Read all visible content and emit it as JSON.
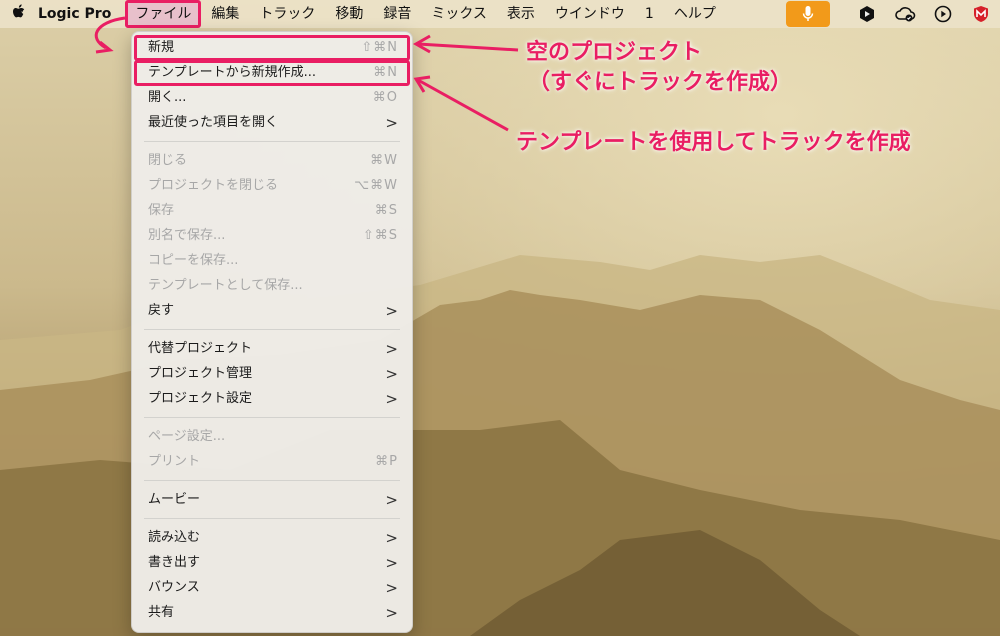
{
  "menubar": {
    "app_name": "Logic Pro",
    "menus": [
      "ファイル",
      "編集",
      "トラック",
      "移動",
      "録音",
      "ミックス",
      "表示",
      "ウインドウ",
      "1",
      "ヘルプ"
    ]
  },
  "file_menu": {
    "items": [
      {
        "label": "新規",
        "shortcut": "⇧⌘N"
      },
      {
        "label": "テンプレートから新規作成...",
        "shortcut": "⌘N"
      },
      {
        "label": "開く...",
        "shortcut": "⌘O"
      },
      {
        "label": "最近使った項目を開く",
        "submenu": ">"
      },
      {
        "label": "閉じる",
        "shortcut": "⌘W"
      },
      {
        "label": "プロジェクトを閉じる",
        "shortcut": "⌥⌘W"
      },
      {
        "label": "保存",
        "shortcut": "⌘S"
      },
      {
        "label": "別名で保存...",
        "shortcut": "⇧⌘S"
      },
      {
        "label": "コピーを保存..."
      },
      {
        "label": "テンプレートとして保存..."
      },
      {
        "label": "戻す",
        "submenu": ">"
      },
      {
        "label": "代替プロジェクト",
        "submenu": ">"
      },
      {
        "label": "プロジェクト管理",
        "submenu": ">"
      },
      {
        "label": "プロジェクト設定",
        "submenu": ">"
      },
      {
        "label": "ページ設定..."
      },
      {
        "label": "プリント",
        "shortcut": "⌘P"
      },
      {
        "label": "ムービー",
        "submenu": ">"
      },
      {
        "label": "読み込む",
        "submenu": ">"
      },
      {
        "label": "書き出す",
        "submenu": ">"
      },
      {
        "label": "バウンス",
        "submenu": ">"
      },
      {
        "label": "共有",
        "submenu": ">"
      }
    ]
  },
  "annotations": {
    "note1_line1": "空のプロジェクト",
    "note1_line2": "（すぐにトラックを作成）",
    "note2": "テンプレートを使用してトラックを作成"
  },
  "colors": {
    "annotation": "#e91e63",
    "mic_button": "#f29a1a"
  }
}
